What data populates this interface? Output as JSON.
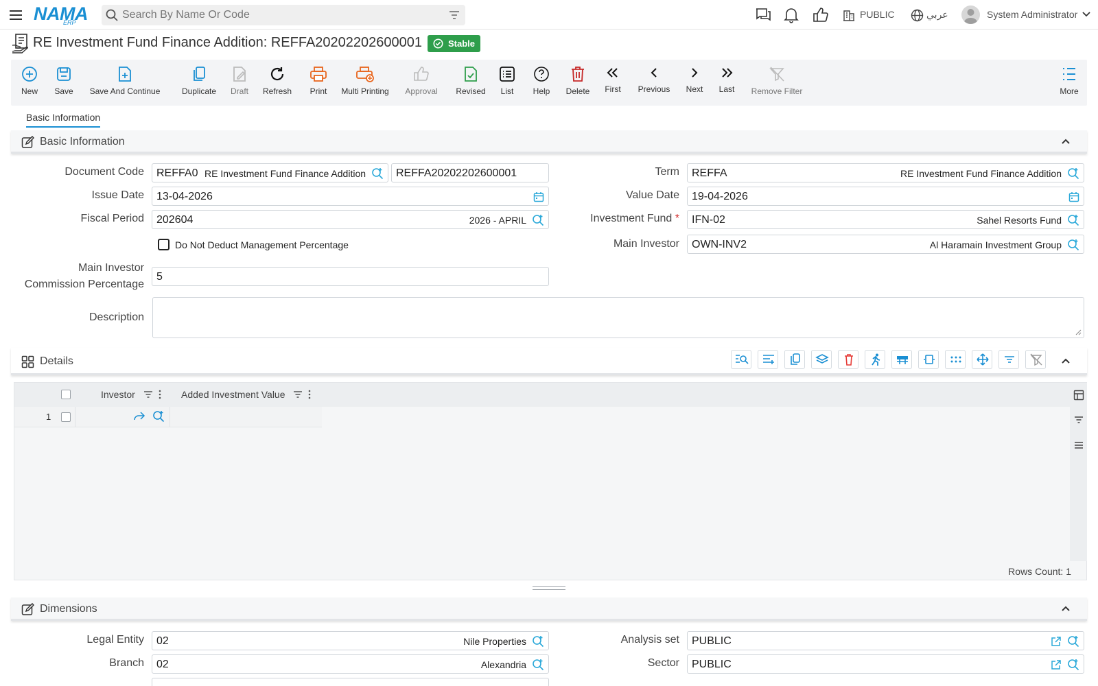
{
  "topbar": {
    "search_placeholder": "Search By Name Or Code",
    "logo_text": "NAMA",
    "logo_sub": "ERP",
    "branch": "PUBLIC",
    "language": "عربي",
    "user": "System Administrator"
  },
  "page": {
    "title": "RE Investment Fund Finance Addition: REFFA20202202600001",
    "status": "Stable"
  },
  "toolbar": {
    "new": "New",
    "save": "Save",
    "save_continue": "Save And Continue",
    "duplicate": "Duplicate",
    "draft": "Draft",
    "refresh": "Refresh",
    "print": "Print",
    "multi_printing": "Multi Printing",
    "approval": "Approval",
    "revised": "Revised",
    "list": "List",
    "help": "Help",
    "delete": "Delete",
    "first": "First",
    "previous": "Previous",
    "next": "Next",
    "last": "Last",
    "remove_filter": "Remove Filter",
    "more": "More"
  },
  "tabs": {
    "basic_info": "Basic Information"
  },
  "basic": {
    "header": "Basic Information",
    "document_code_label": "Document Code",
    "document_code": "REFFA0",
    "document_code_desc": "RE Investment Fund Finance Addition",
    "document_number": "REFFA20202202600001",
    "issue_date_label": "Issue Date",
    "issue_date": "13-04-2026",
    "fiscal_period_label": "Fiscal Period",
    "fiscal_period": "202604",
    "fiscal_period_desc": "2026 - APRIL",
    "no_deduct_label": "Do Not Deduct Management Percentage",
    "commission_label_1": "Main Investor",
    "commission_label_2": "Commission Percentage",
    "commission": "5",
    "description_label": "Description",
    "term_label": "Term",
    "term": "REFFA",
    "term_desc": "RE Investment Fund Finance Addition",
    "value_date_label": "Value Date",
    "value_date": "19-04-2026",
    "investment_fund_label": "Investment Fund",
    "required_mark": "*",
    "investment_fund": "IFN-02",
    "investment_fund_desc": "Sahel Resorts Fund",
    "main_investor_label": "Main Investor",
    "main_investor": "OWN-INV2",
    "main_investor_desc": "Al Haramain Investment Group"
  },
  "details": {
    "header": "Details",
    "col_investor": "Investor",
    "col_added_value": "Added Investment Value",
    "row_number": "1",
    "rows_count": "Rows Count: 1"
  },
  "dimensions": {
    "header": "Dimensions",
    "legal_entity_label": "Legal Entity",
    "legal_entity": "02",
    "legal_entity_desc": "Nile Properties",
    "branch_label": "Branch",
    "branch": "02",
    "branch_desc": "Alexandria",
    "analysis_set_label": "Analysis set",
    "analysis_set": "PUBLIC",
    "sector_label": "Sector",
    "sector": "PUBLIC"
  },
  "colors": {
    "accent": "#1a8fd3",
    "success": "#2e9e4b",
    "danger": "#d32f2f",
    "print": "#e8651c"
  }
}
